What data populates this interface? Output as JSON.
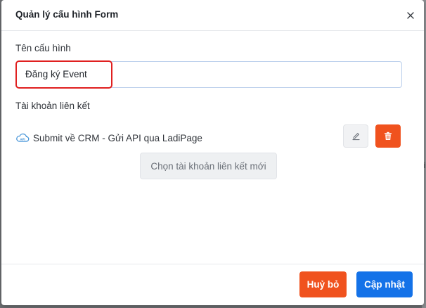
{
  "modal": {
    "title": "Quản lý cấu hình Form",
    "close_icon": "close-icon"
  },
  "config_name": {
    "label": "Tên cấu hình",
    "value": "Đăng ký Event"
  },
  "linked_account": {
    "label": "Tài khoản liên kết",
    "account_icon": "cloud-api-icon",
    "account_text": "Submit về CRM - Gửi API qua LadiPage",
    "edit_icon": "pencil-icon",
    "delete_icon": "trash-icon",
    "add_button_label": "Chọn tài khoản liên kết mới"
  },
  "footer": {
    "cancel_label": "Huỷ bỏ",
    "update_label": "Cập nhật"
  },
  "backdrop": {
    "right_glyph": "li"
  },
  "colors": {
    "primary": "#1472e8",
    "danger": "#f0521e",
    "highlight": "#e02020"
  }
}
